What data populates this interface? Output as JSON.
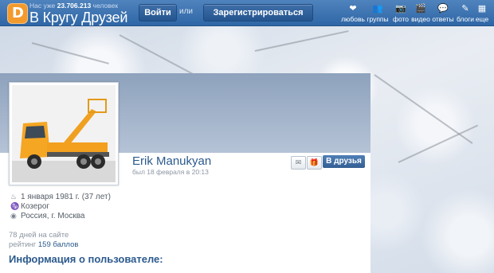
{
  "header": {
    "logo_letter": "D",
    "counter_prefix": "Нас уже",
    "counter_value": "23.706.213",
    "counter_suffix": "человек",
    "brand": "В Кругу Друзей",
    "login_label": "Войти",
    "or_label": "или",
    "register_label": "Зарегистрироваться",
    "nav": [
      {
        "label": "любовь",
        "icon": "heart-icon",
        "glyph": "❤"
      },
      {
        "label": "группы",
        "icon": "groups-icon",
        "glyph": "👥"
      },
      {
        "label": "фото",
        "icon": "camera-icon",
        "glyph": "📷"
      },
      {
        "label": "видео",
        "icon": "video-icon",
        "glyph": "🎬"
      },
      {
        "label": "ответы",
        "icon": "answers-icon",
        "glyph": "💬"
      },
      {
        "label": "блоги",
        "icon": "blog-icon",
        "glyph": "✎"
      },
      {
        "label": "еще",
        "icon": "more-icon",
        "glyph": "▦"
      }
    ]
  },
  "profile": {
    "name": "Erik Manukyan",
    "last_seen": "был 18 февраля в 20:13",
    "message_icon": "envelope-icon",
    "gift_icon": "gift-icon",
    "add_friend_label": "В друзья",
    "birthday": "1 января 1981 г. (37 лет)",
    "zodiac": "Козерог",
    "location": "Россия, г. Москва",
    "days_on_site": "78 дней на сайте",
    "rating_prefix": "рейтинг",
    "rating_value": "159 баллов",
    "section_title": "Информация о пользователе:"
  },
  "colors": {
    "topbar": "#3a70ae",
    "accent_orange": "#f39a2d",
    "link_blue": "#2b5a8d"
  }
}
